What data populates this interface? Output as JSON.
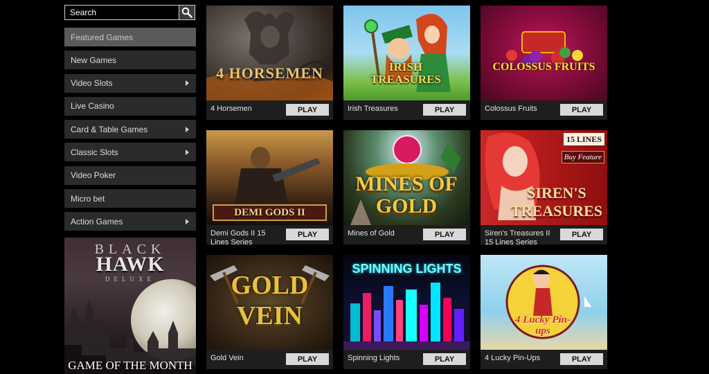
{
  "search": {
    "placeholder": "Search"
  },
  "sidebar": {
    "items": [
      {
        "label": "Featured Games",
        "active": true,
        "has_submenu": false
      },
      {
        "label": "New Games",
        "active": false,
        "has_submenu": false
      },
      {
        "label": "Video Slots",
        "active": false,
        "has_submenu": true
      },
      {
        "label": "Live Casino",
        "active": false,
        "has_submenu": false
      },
      {
        "label": "Card & Table Games",
        "active": false,
        "has_submenu": true
      },
      {
        "label": "Classic Slots",
        "active": false,
        "has_submenu": true
      },
      {
        "label": "Video Poker",
        "active": false,
        "has_submenu": false
      },
      {
        "label": "Micro bet",
        "active": false,
        "has_submenu": false
      },
      {
        "label": "Action Games",
        "active": false,
        "has_submenu": true
      }
    ]
  },
  "game_of_month": {
    "logo_top": "BLACK",
    "logo_main": "HAWK",
    "logo_sub": "DELUXE",
    "caption": "GAME OF THE MONTH"
  },
  "games": [
    {
      "name": "4 Horsemen",
      "art_text": "4 HORSEMEN",
      "play_label": "PLAY"
    },
    {
      "name": "Irish Treasures",
      "art_text": "IRISH TREASURES",
      "play_label": "PLAY"
    },
    {
      "name": "Colossus Fruits",
      "art_text": "COLOSSUS FRUITS",
      "play_label": "PLAY"
    },
    {
      "name": "Demi Gods II 15 Lines Series",
      "art_text": "DEMI GODS II",
      "play_label": "PLAY"
    },
    {
      "name": "Mines of Gold",
      "art_text": "MINES OF GOLD",
      "play_label": "PLAY"
    },
    {
      "name": "Siren's Treasures II 15 Lines Series",
      "art_text": "SIREN'S TREASURES",
      "badge_lines": "15 LINES",
      "badge_feature": "Buy Feature",
      "play_label": "PLAY"
    },
    {
      "name": "Gold Vein",
      "art_text": "GOLD VEIN",
      "play_label": "PLAY"
    },
    {
      "name": "Spinning Lights",
      "art_text": "SPINNING LIGHTS",
      "play_label": "PLAY"
    },
    {
      "name": "4 Lucky Pin-Ups",
      "art_text": "4 Lucky Pin-ups",
      "play_label": "PLAY"
    }
  ],
  "colors": {
    "background": "#000000",
    "sidebar_item": "#2b2b2b",
    "sidebar_item_active": "#5a5a5a",
    "play_button": "#d9d9d9"
  }
}
